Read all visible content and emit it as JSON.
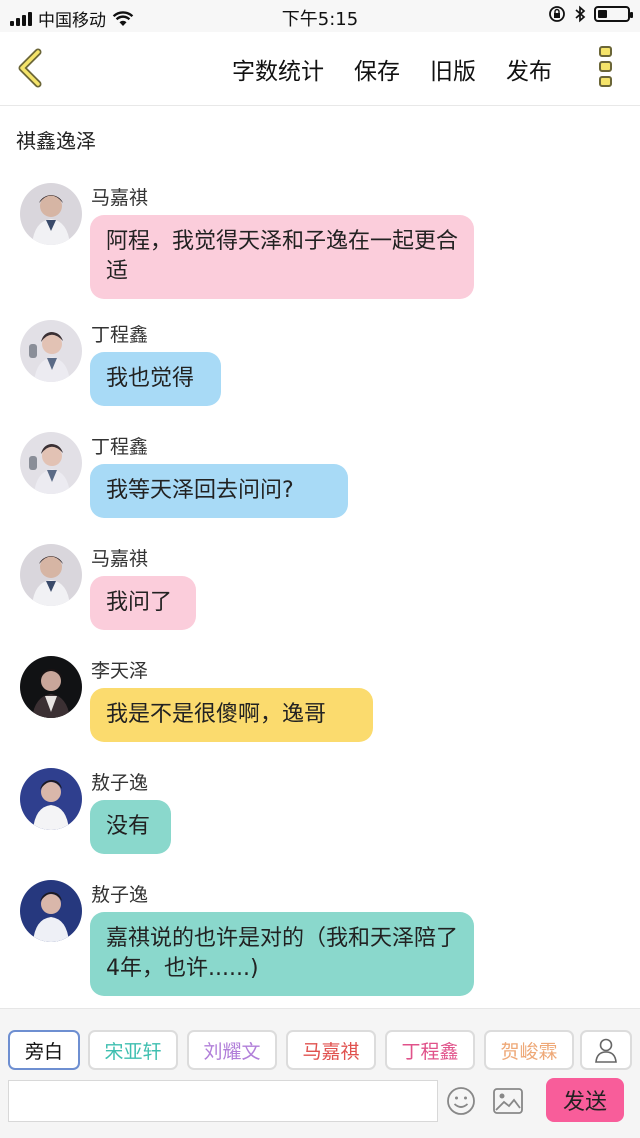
{
  "status_bar": {
    "carrier": "中国移动",
    "time": "下午5:15"
  },
  "nav": {
    "actions": [
      "字数统计",
      "保存",
      "旧版",
      "发布"
    ]
  },
  "story_title": "祺鑫逸泽",
  "messages": [
    {
      "name": "马嘉祺",
      "text": "阿程，我觉得天泽和子逸在一起更合适",
      "color": "#fbcddb"
    },
    {
      "name": "丁程鑫",
      "text": "我也觉得",
      "color": "#a8daf6"
    },
    {
      "name": "丁程鑫",
      "text": "我等天泽回去问问?",
      "color": "#a8daf6"
    },
    {
      "name": "马嘉祺",
      "text": "我问了",
      "color": "#fbcddb"
    },
    {
      "name": "李天泽",
      "text": "我是不是很傻啊，逸哥",
      "color": "#fbdb6e"
    },
    {
      "name": "敖子逸",
      "text": "没有",
      "color": "#8ad8cc"
    },
    {
      "name": "敖子逸",
      "text": "嘉祺说的也许是对的（我和天泽陪了4年，也许......)",
      "color": "#8ad8cc"
    }
  ],
  "roles": [
    {
      "label": "旁白",
      "color": "#111111"
    },
    {
      "label": "宋亚轩",
      "color": "#3fbfb0"
    },
    {
      "label": "刘耀文",
      "color": "#b17fd9"
    },
    {
      "label": "马嘉祺",
      "color": "#e0524f"
    },
    {
      "label": "丁程鑫",
      "color": "#e0528a"
    },
    {
      "label": "贺峻霖",
      "color": "#eea877"
    }
  ],
  "input": {
    "value": "",
    "send_label": "发送"
  }
}
